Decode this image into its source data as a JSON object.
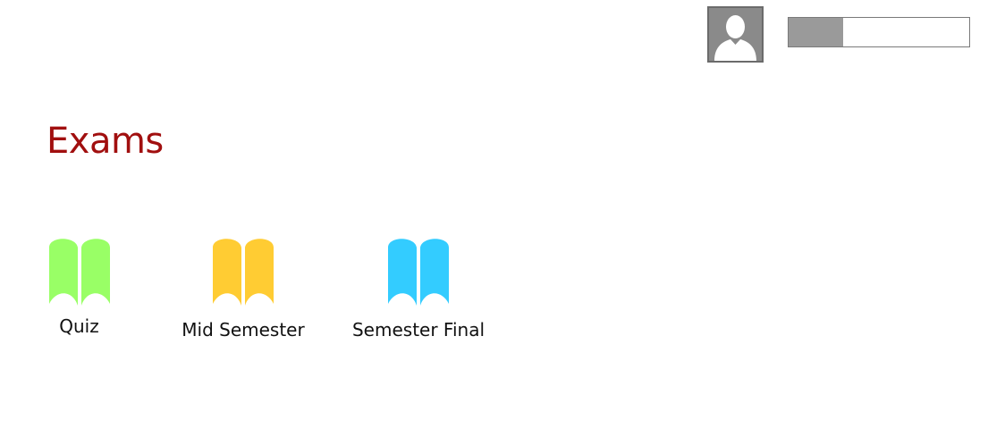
{
  "header": {
    "avatar_icon": "user-avatar-icon",
    "progress": 0.3
  },
  "page": {
    "title": "Exams",
    "title_color": "#a10f0f"
  },
  "exams": [
    {
      "label": "Quiz",
      "icon": "book-icon",
      "color": "#99ff66"
    },
    {
      "label": "Mid Semester",
      "icon": "book-icon",
      "color": "#ffcc33"
    },
    {
      "label": "Semester Final",
      "icon": "book-icon",
      "color": "#33ccff"
    }
  ]
}
